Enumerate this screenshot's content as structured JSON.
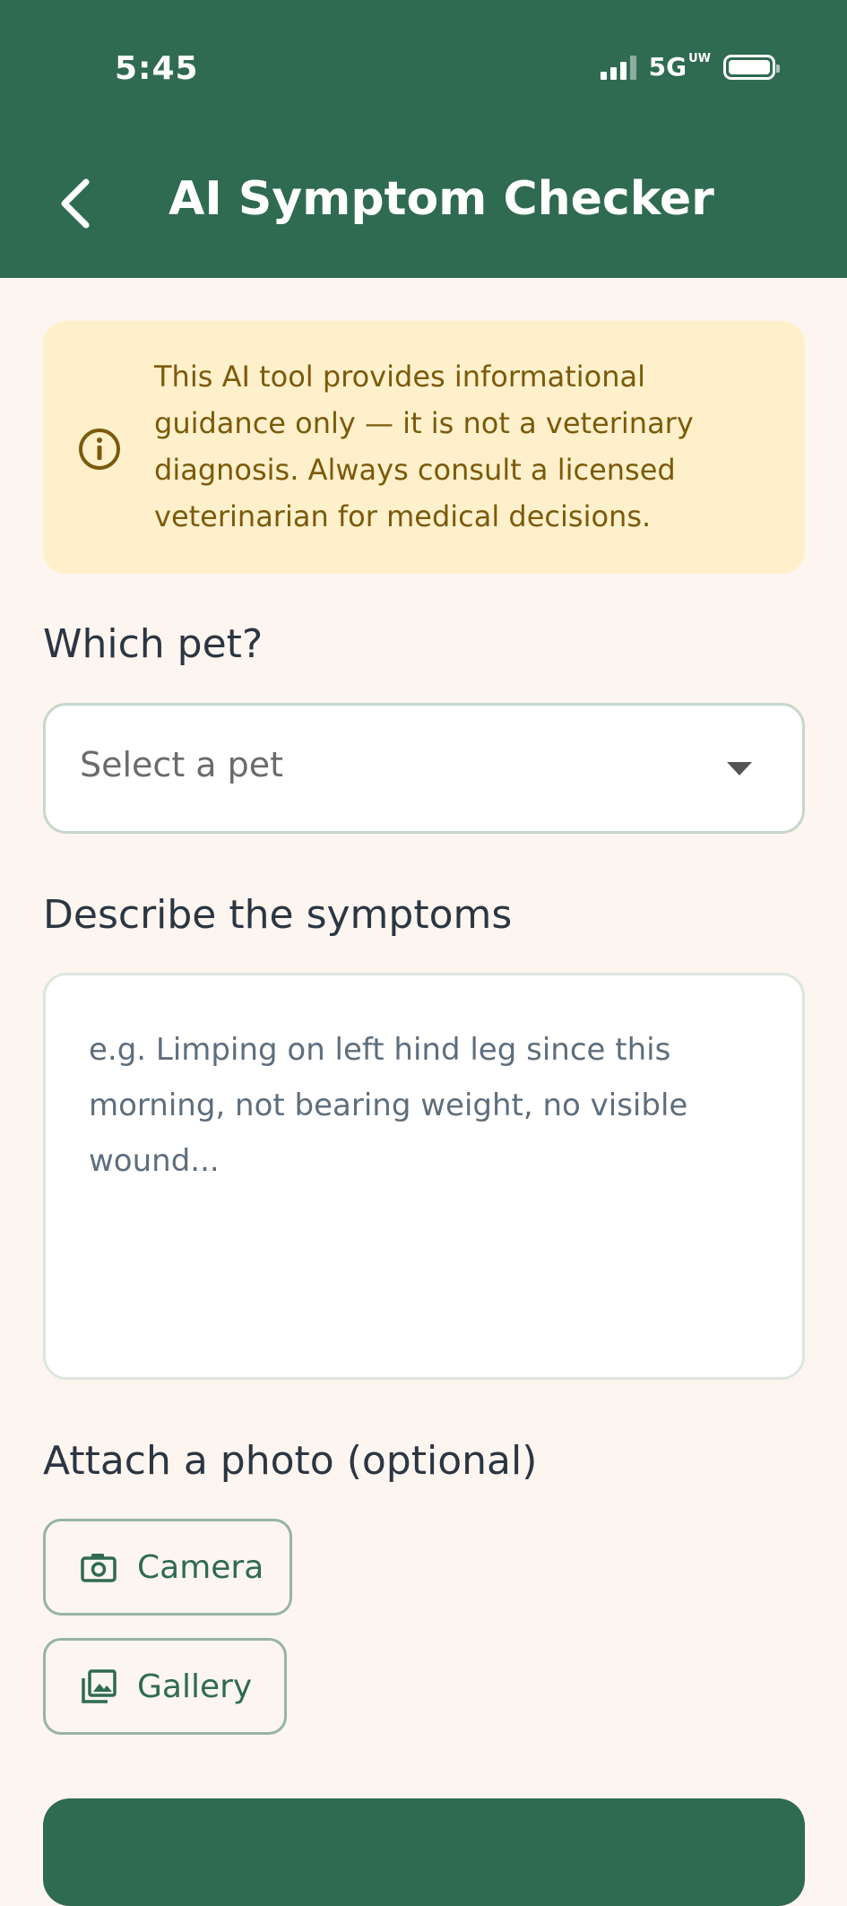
{
  "status_bar": {
    "time": "5:45",
    "network": "5G",
    "network_suffix": "UW"
  },
  "header": {
    "title": "AI Symptom Checker",
    "back_icon": "chevron-left-icon"
  },
  "notice": {
    "icon": "info-circle-icon",
    "text": "This AI tool provides informational guidance only — it is not a veterinary diagnosis. Always consult a licensed veterinarian for medical decisions."
  },
  "pet_select": {
    "label": "Which pet?",
    "value": "Select a pet"
  },
  "symptoms": {
    "label": "Describe the symptoms",
    "placeholder": "e.g. Limping on left hind leg since this morning, not bearing weight, no visible wound...",
    "value": ""
  },
  "photo": {
    "label": "Attach a photo (optional)",
    "camera_label": "Camera",
    "camera_icon": "camera-icon",
    "gallery_label": "Gallery",
    "gallery_icon": "gallery-icon"
  },
  "colors": {
    "primary": "#2F6B50",
    "background": "#FDF5EF",
    "notice_bg": "#FEF0CB",
    "notice_text": "#7B5A0B"
  }
}
